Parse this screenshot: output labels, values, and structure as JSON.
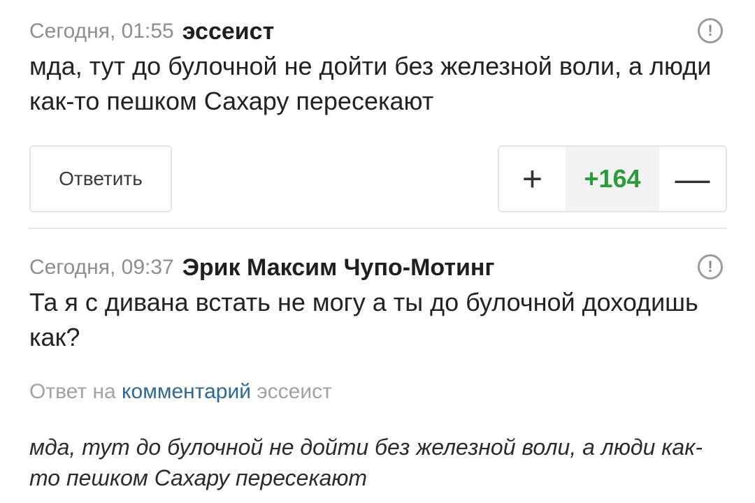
{
  "comments": [
    {
      "time": "Сегодня, 01:55",
      "author": "эссеист",
      "text": "мда, тут до булочной не дойти без железной воли, а люди как-то пешком Сахару пересекают",
      "report_icon": "!",
      "reply_label": "Ответить",
      "vote": {
        "plus": "+",
        "score": "+164",
        "minus": "—"
      }
    },
    {
      "time": "Сегодня, 09:37",
      "author": "Эрик Максим Чупо-Мотинг",
      "text": "Та я с дивана встать не могу а ты до булочной доходишь как?",
      "report_icon": "!",
      "reply_to": {
        "prefix": "Ответ на",
        "link": "комментарий",
        "author": "эссеист"
      },
      "quote": "мда, тут до булочной не дойти без железной воли, а люди как-то пешком Сахару пересекают"
    }
  ],
  "colors": {
    "score_positive": "#2a9d3a",
    "link": "#2a6a98",
    "meta": "#8e8e8e"
  }
}
